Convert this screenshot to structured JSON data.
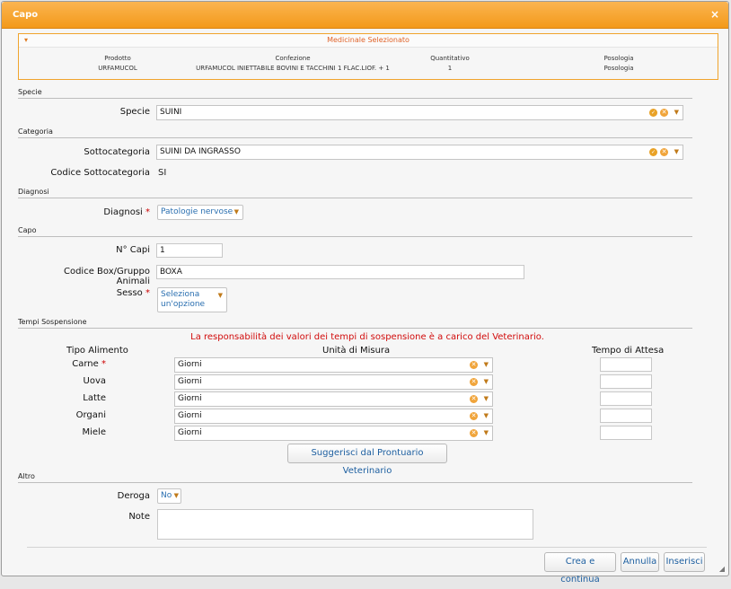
{
  "dialog": {
    "title": "Capo",
    "close_glyph": "×"
  },
  "medicinal": {
    "panel_title": "Medicinale Selezionato",
    "toggle_glyph": "▾",
    "columns": [
      {
        "header": "Prodotto",
        "value": "URFAMUCOL"
      },
      {
        "header": "Confezione",
        "value": "URFAMUCOL INIETTABILE BOVINI E TACCHINI 1 FLAC.LIOF. + 1"
      },
      {
        "header": "Quantitativo",
        "value": "1"
      },
      {
        "header": "Posologia",
        "value": "Posologia"
      }
    ]
  },
  "sections": {
    "specie": "Specie",
    "categoria": "Categoria",
    "diagnosi": "Diagnosi",
    "capo": "Capo",
    "tempi": "Tempi Sospensione",
    "altro": "Altro"
  },
  "specie": {
    "label": "Specie",
    "value": "SUINI"
  },
  "categoria": {
    "sotto_label": "Sottocategoria",
    "sotto_value": "SUINI DA INGRASSO",
    "codice_label": "Codice Sottocategoria",
    "codice_value": "SI"
  },
  "diagnosi": {
    "label": "Diagnosi",
    "required": "*",
    "value": "Patologie nervose"
  },
  "capo": {
    "ncapi_label": "N° Capi",
    "ncapi_value": "1",
    "box_label": "Codice Box/Gruppo Animali",
    "box_value": "BOXA",
    "sesso_label": "Sesso",
    "sesso_required": "*",
    "sesso_value_line1": "Seleziona",
    "sesso_value_line2": "un'opzione"
  },
  "tempi": {
    "warning": "La responsabilità dei valori dei tempi di sospensione è a carico del Veterinario.",
    "col_tipo": "Tipo Alimento",
    "col_unita": "Unità di Misura",
    "col_tempo": "Tempo di Attesa",
    "rows": [
      {
        "tipo": "Carne",
        "required": "*",
        "unita": "Giorni",
        "tempo": ""
      },
      {
        "tipo": "Uova",
        "required": "",
        "unita": "Giorni",
        "tempo": ""
      },
      {
        "tipo": "Latte",
        "required": "",
        "unita": "Giorni",
        "tempo": ""
      },
      {
        "tipo": "Organi",
        "required": "",
        "unita": "Giorni",
        "tempo": ""
      },
      {
        "tipo": "Miele",
        "required": "",
        "unita": "Giorni",
        "tempo": ""
      }
    ],
    "suggest_button": "Suggerisci dal Prontuario Veterinario"
  },
  "altro": {
    "deroga_label": "Deroga",
    "deroga_value": "No",
    "note_label": "Note",
    "note_value": ""
  },
  "footer": {
    "crea_button": "Crea e continua",
    "annulla_button": "Annulla",
    "inserisci_button": "Inserisci"
  },
  "icons": {
    "ok": "✓",
    "clear": "✕",
    "caret": "▼",
    "resize_grip": "◢"
  },
  "colors": {
    "accent": "#f39a1a",
    "link_blue": "#1d5fa0",
    "warning_red": "#d10b0b"
  }
}
